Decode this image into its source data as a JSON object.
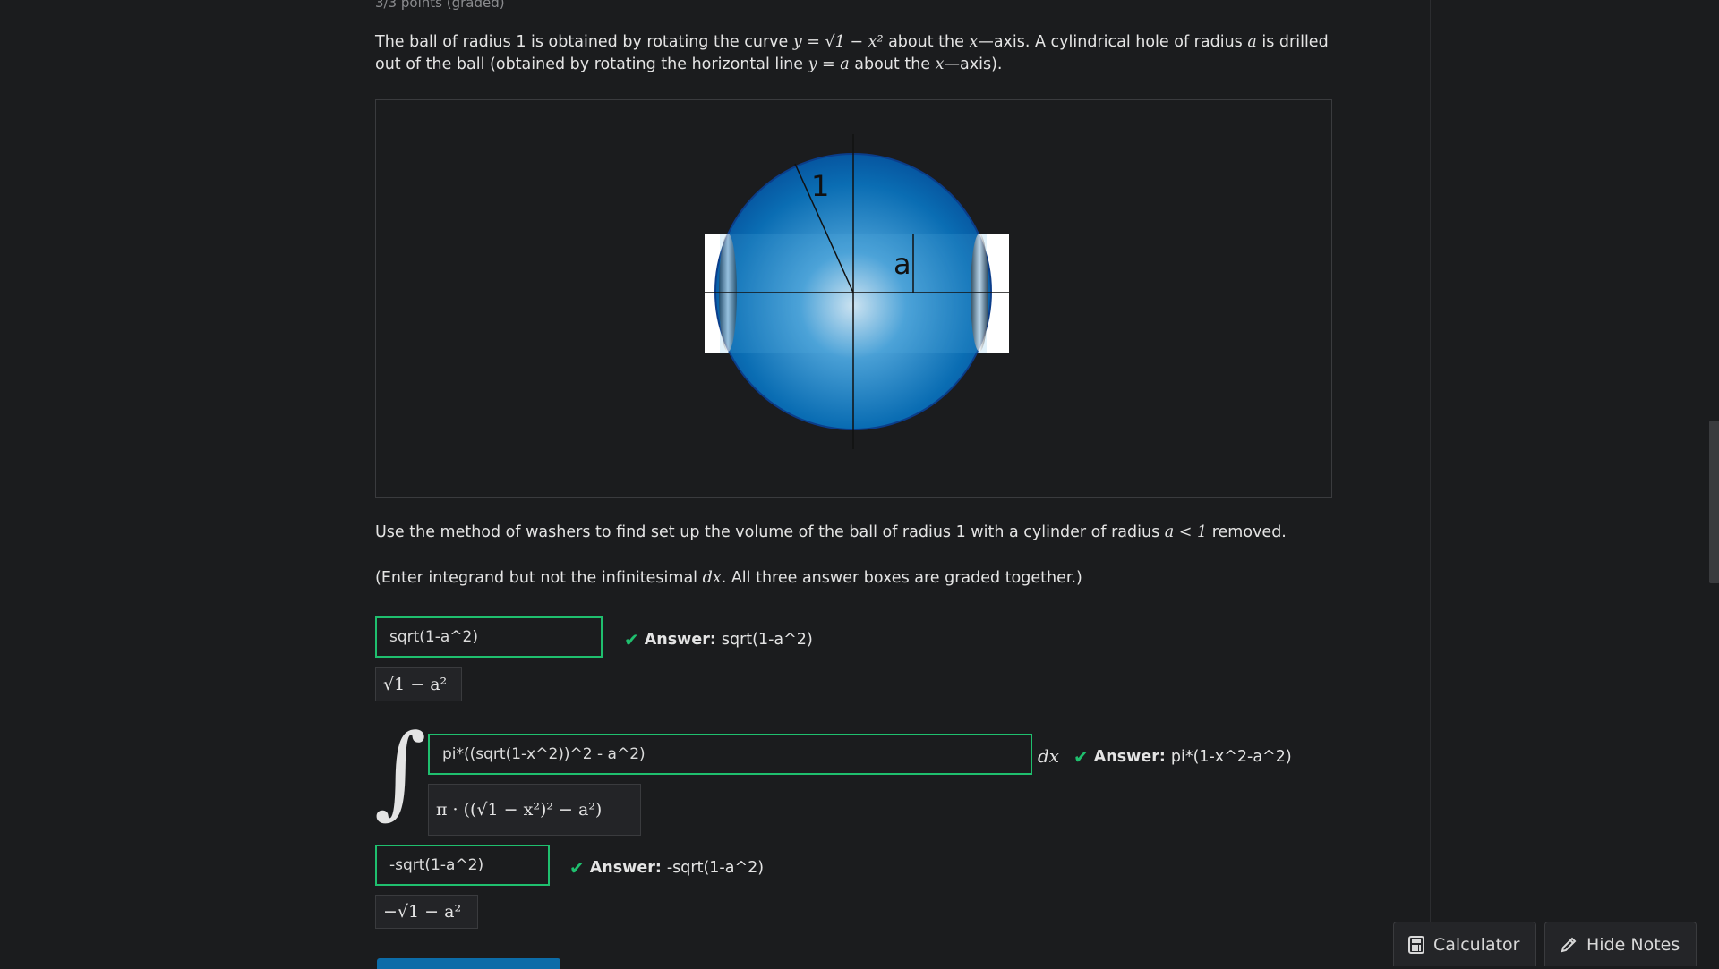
{
  "question": {
    "points": "3/3 points (graded)",
    "p1_a": "The ball of radius 1 is obtained by rotating the curve",
    "p1_eq1": "y = √1 − x²",
    "p1_b": "about the",
    "p1_x1": "x",
    "p1_c": "—axis. A cylindrical hole of radius",
    "p1_a_var": "a",
    "p1_d": "is drilled",
    "p2_a": "out of the ball (obtained by rotating the horizontal line",
    "p2_eq": "y = a",
    "p2_b": "about the",
    "p2_x": "x",
    "p2_c": "—axis).",
    "p3_a": "Use the method of washers to find set up the volume of the ball of radius 1 with a cylinder of radius",
    "p3_eq": "a < 1",
    "p3_b": "removed.",
    "p4_a": "(Enter integrand but not the infinitesimal",
    "p4_dx": "dx",
    "p4_b": ". All three answer boxes are graded together.)"
  },
  "figure": {
    "label_radius": "1",
    "label_a": "a"
  },
  "answers": {
    "upper_value": "sqrt(1-a^2)",
    "upper_preview": "√1 − a²",
    "upper_answer_label": "Answer:",
    "upper_answer": "sqrt(1-a^2)",
    "integrand_value": "pi*((sqrt(1-x^2))^2 - a^2)",
    "integrand_preview": "π · ((√1 − x²)² − a²)",
    "integrand_answer_label": "Answer:",
    "integrand_answer": "pi*(1-x^2-a^2)",
    "dx": "dx",
    "lower_value": "-sqrt(1-a^2)",
    "lower_preview": "−√1 − a²",
    "lower_answer_label": "Answer:",
    "lower_answer": "-sqrt(1-a^2)"
  },
  "toolbar": {
    "calculator": "Calculator",
    "hide_notes": "Hide Notes"
  },
  "colors": {
    "correct": "#1fbf6e",
    "sphere": "#0a6db3",
    "background": "#1b1c1e"
  }
}
